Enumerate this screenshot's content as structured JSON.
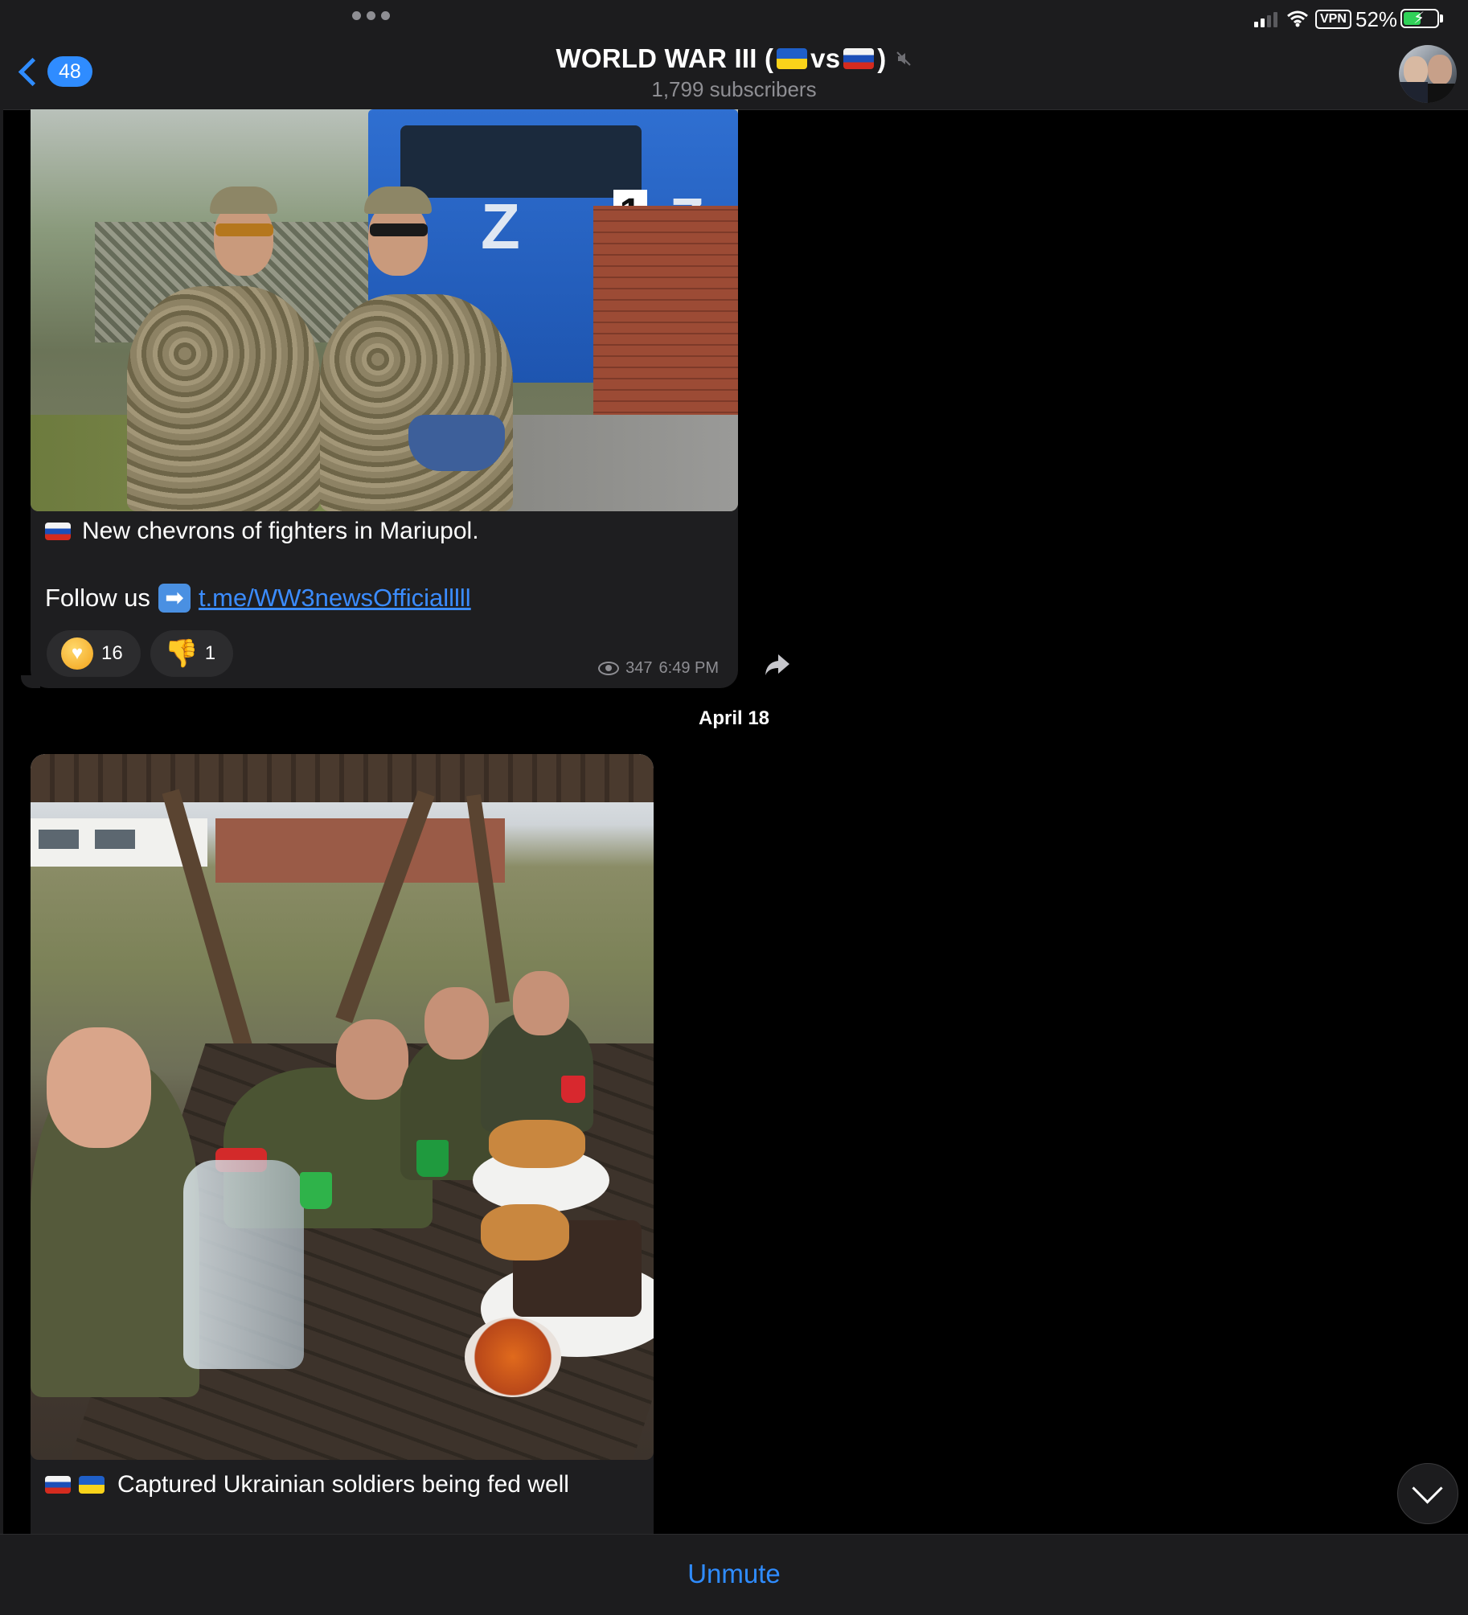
{
  "status_bar": {
    "battery_percent": "52%",
    "vpn_label": "VPN",
    "battery_level": 0.52
  },
  "header": {
    "back_count": "48",
    "title_prefix": "WORLD WAR III (",
    "title_vs": "vs",
    "title_suffix": ")",
    "subtitle": "1,799 subscribers",
    "muted_icon": "speaker-muted-icon"
  },
  "messages": [
    {
      "caption": "New chevrons of fighters in Mariupol.",
      "follow_text": "Follow us",
      "link": "t.me/WW3newsOfficialllll",
      "reactions": [
        {
          "icon": "smiling-face-with-hearts-icon",
          "count": "16"
        },
        {
          "icon": "thumbs-down-icon",
          "count": "1"
        }
      ],
      "views": "347",
      "time": "6:49 PM"
    },
    {
      "caption": "Captured Ukrainian soldiers being fed well"
    }
  ],
  "date_separator": "April 18",
  "bottom_bar": {
    "unmute_label": "Unmute"
  },
  "colors": {
    "accent": "#2f8cff",
    "background": "#000000",
    "bubble": "#1e1e20"
  }
}
